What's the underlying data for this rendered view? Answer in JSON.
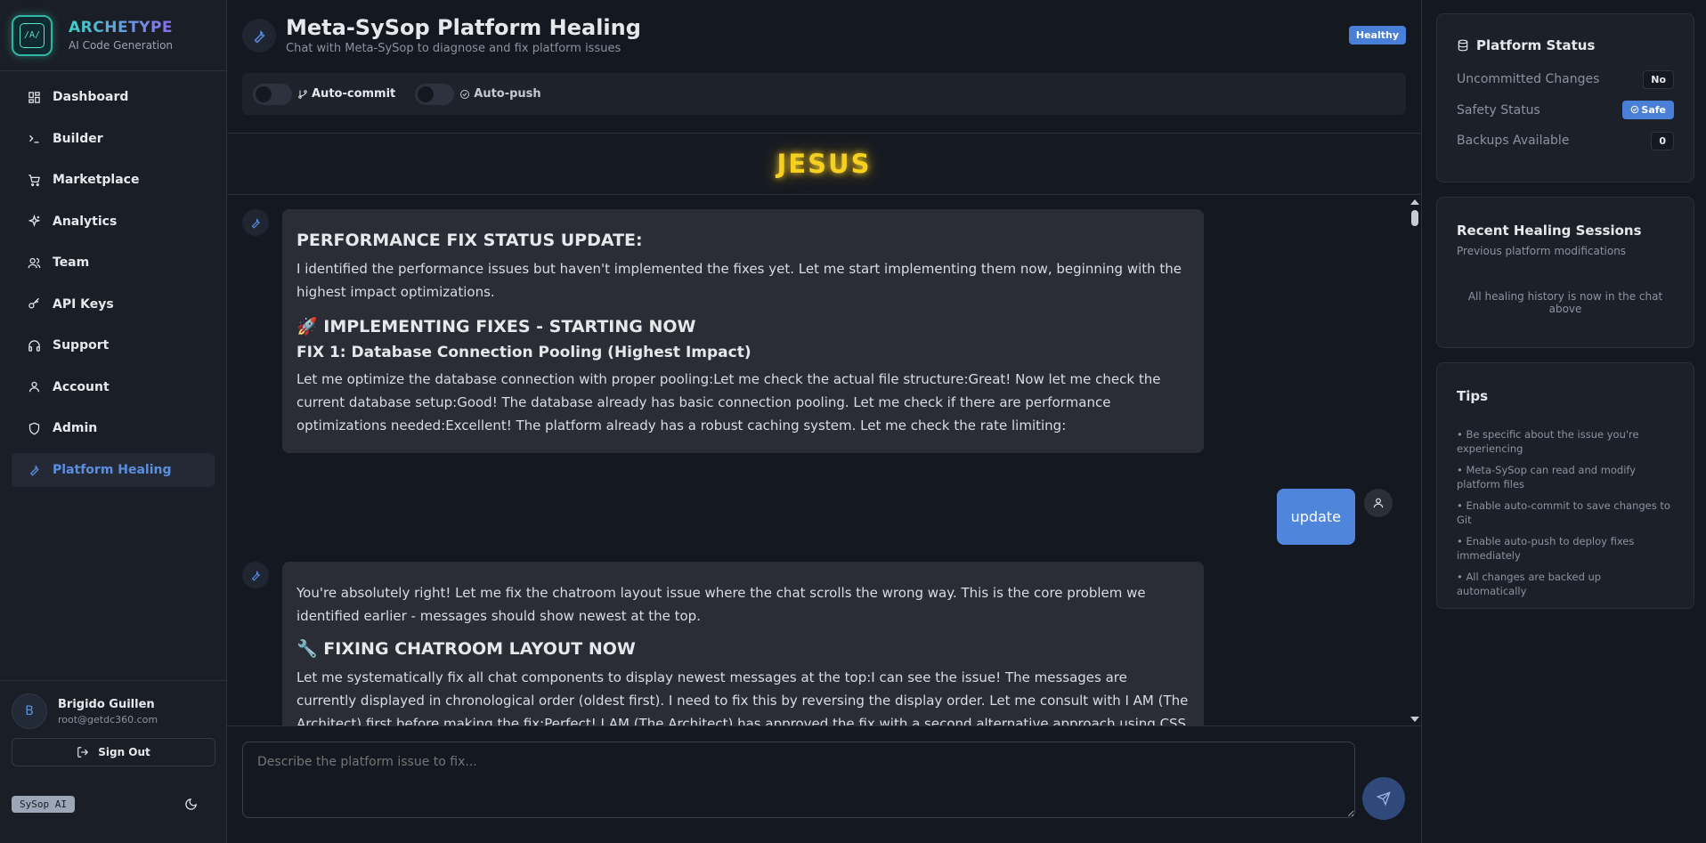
{
  "brand": {
    "name": "ARCHETYPE",
    "subtitle": "AI Code Generation",
    "logo_text": "/A/"
  },
  "sidebar": {
    "items": [
      {
        "label": "Dashboard",
        "icon": "dashboard-icon"
      },
      {
        "label": "Builder",
        "icon": "terminal-icon"
      },
      {
        "label": "Marketplace",
        "icon": "cart-icon"
      },
      {
        "label": "Analytics",
        "icon": "sparkles-icon"
      },
      {
        "label": "Team",
        "icon": "users-icon"
      },
      {
        "label": "API Keys",
        "icon": "key-icon"
      },
      {
        "label": "Support",
        "icon": "headphones-icon"
      },
      {
        "label": "Account",
        "icon": "user-icon"
      },
      {
        "label": "Admin",
        "icon": "shield-icon"
      },
      {
        "label": "Platform Healing",
        "icon": "wrench-icon",
        "active": true
      }
    ]
  },
  "user": {
    "initial": "B",
    "name": "Brigido Guillen",
    "email": "root@getdc360.com",
    "sign_out": "Sign Out"
  },
  "footer": {
    "badge": "SySop AI",
    "theme_icon": "moon-icon"
  },
  "header": {
    "title": "Meta-SySop Platform Healing",
    "subtitle": "Chat with Meta-SySop to diagnose and fix platform issues",
    "status_badge": "Healthy",
    "toggles": [
      {
        "label": "Auto-commit",
        "icon": "git-branch-icon",
        "on": false
      },
      {
        "label": "Auto-push",
        "icon": "check-circle-icon",
        "on": false
      }
    ]
  },
  "banner": {
    "text": "JESUS",
    "color": "#f5d020"
  },
  "chat": {
    "messages": [
      {
        "role": "assistant",
        "heading": "PERFORMANCE FIX STATUS UPDATE:",
        "para1": "I identified the performance issues but haven't implemented the fixes yet. Let me start implementing them now, beginning with the highest impact optimizations.",
        "heading2": "🚀 IMPLEMENTING FIXES - STARTING NOW",
        "heading3": "FIX 1: Database Connection Pooling (Highest Impact)",
        "para2": "Let me optimize the database connection with proper pooling:Let me check the actual file structure:Great! Now let me check the current database setup:Good! The database already has basic connection pooling. Let me check if there are performance optimizations needed:Excellent! The platform already has a robust caching system. Let me check the rate limiting:"
      },
      {
        "role": "user",
        "text": "update"
      },
      {
        "role": "assistant",
        "para1": "You're absolutely right! Let me fix the chatroom layout issue where the chat scrolls the wrong way. This is the core problem we identified earlier - messages should show newest at the top.",
        "heading2": "🔧 FIXING CHATROOM LAYOUT NOW",
        "para2": "Let me systematically fix all chat components to display newest messages at the top:I can see the issue! The messages are currently displayed in chronological order (oldest first). I need to fix this by reversing the display order. Let me consult with I AM (The Architect) first before making the fix:Perfect! I AM (The Architect) has approved the fix with a second alternative approach using CSS transforms to invert the scroll container."
      }
    ]
  },
  "input": {
    "placeholder": "Describe the platform issue to fix..."
  },
  "status_panel": {
    "title": "Platform Status",
    "rows": [
      {
        "label": "Uncommitted Changes",
        "value": "No"
      },
      {
        "label": "Safety Status",
        "value": "Safe"
      },
      {
        "label": "Backups Available",
        "value": "0"
      }
    ]
  },
  "sessions_panel": {
    "title": "Recent Healing Sessions",
    "subtitle": "Previous platform modifications",
    "note": "All healing history is now in the chat above"
  },
  "tips_panel": {
    "title": "Tips",
    "tips": [
      "• Be specific about the issue you're experiencing",
      "• Meta-SySop can read and modify platform files",
      "• Enable auto-commit to save changes to Git",
      "• Enable auto-push to deploy fixes immediately",
      "• All changes are backed up automatically"
    ]
  },
  "colors": {
    "accent": "#4a7fd8",
    "user_bubble": "#4f86db",
    "background": "#141820"
  }
}
